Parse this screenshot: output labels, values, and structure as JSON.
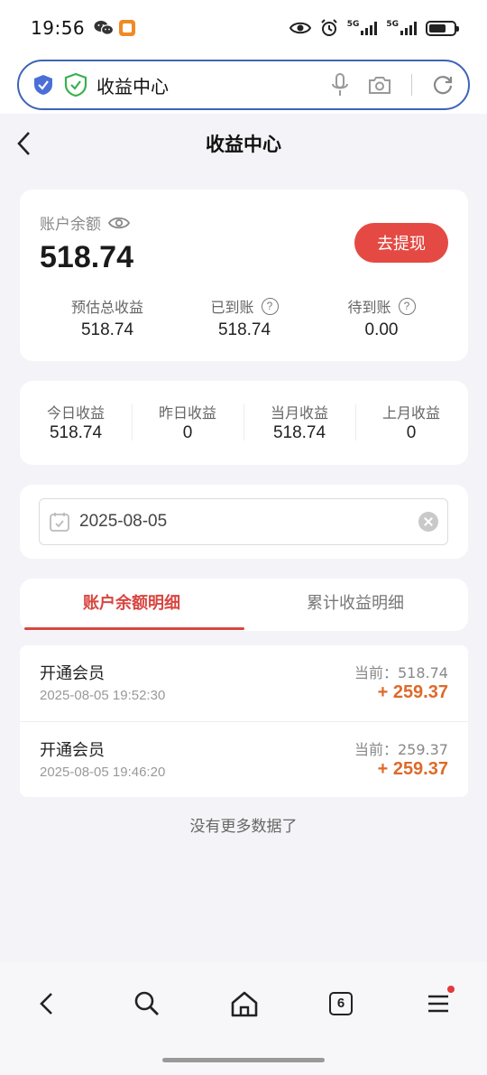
{
  "status_bar": {
    "time": "19:56",
    "net1": "5G",
    "net2": "5G"
  },
  "browser": {
    "url_title": "收益中心"
  },
  "page": {
    "title": "收益中心"
  },
  "balance": {
    "label": "账户余额",
    "amount": "518.74",
    "withdraw_label": "去提现",
    "stats": [
      {
        "label": "预估总收益",
        "value": "518.74"
      },
      {
        "label": "已到账",
        "value": "518.74"
      },
      {
        "label": "待到账",
        "value": "0.00"
      }
    ]
  },
  "period_stats": [
    {
      "label": "今日收益",
      "value": "518.74"
    },
    {
      "label": "昨日收益",
      "value": "0"
    },
    {
      "label": "当月收益",
      "value": "518.74"
    },
    {
      "label": "上月收益",
      "value": "0"
    }
  ],
  "date_filter": {
    "value": "2025-08-05"
  },
  "tabs": [
    {
      "label": "账户余额明细",
      "active": true
    },
    {
      "label": "累计收益明细",
      "active": false
    }
  ],
  "records": [
    {
      "title": "开通会员",
      "time": "2025-08-05 19:52:30",
      "current": "当前：518.74",
      "amount": "+ 259.37"
    },
    {
      "title": "开通会员",
      "time": "2025-08-05 19:46:20",
      "current": "当前：259.37",
      "amount": "+ 259.37"
    }
  ],
  "footer_text": "没有更多数据了",
  "bottom_nav": {
    "tab_count": "6"
  },
  "colors": {
    "accent_red": "#e44a43",
    "amount_orange": "#dd6a2a",
    "url_border": "#3f63b8"
  },
  "icons": [
    "wechat-icon",
    "app-notification-icon",
    "eye-icon",
    "alarm-icon",
    "signal-icon",
    "battery-icon",
    "shield-icon",
    "microphone-icon",
    "camera-icon",
    "refresh-icon",
    "back-icon",
    "help-icon",
    "calendar-icon",
    "clear-icon",
    "search-icon",
    "home-icon",
    "menu-icon"
  ]
}
